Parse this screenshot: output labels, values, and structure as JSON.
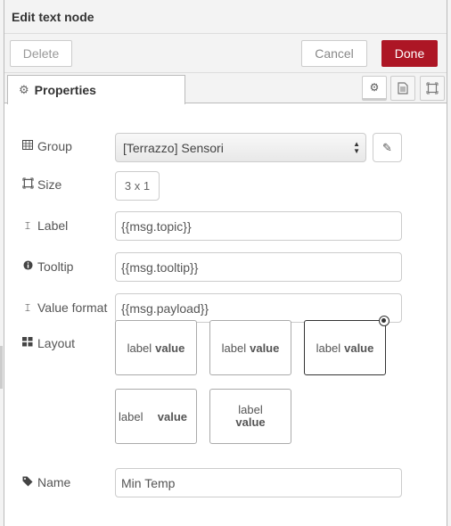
{
  "title": "Edit text node",
  "toolbar": {
    "delete_label": "Delete",
    "cancel_label": "Cancel",
    "done_label": "Done"
  },
  "tabs": [
    {
      "label": "Properties",
      "icon": "gear-icon"
    }
  ],
  "tab_icons": [
    "gear-icon",
    "document-icon",
    "frame-icon"
  ],
  "form": {
    "group": {
      "label": "Group",
      "value": "[Terrazzo] Sensori"
    },
    "size": {
      "label": "Size",
      "value": "3 x 1"
    },
    "label": {
      "label": "Label",
      "value": "{{msg.topic}}"
    },
    "tooltip": {
      "label": "Tooltip",
      "value": "{{msg.tooltip}}"
    },
    "value_format": {
      "label": "Value format",
      "value": "{{msg.payload}}"
    },
    "layout": {
      "label": "Layout",
      "options": [
        {
          "label": "label",
          "value": "value"
        },
        {
          "label": "label",
          "value": "value"
        },
        {
          "label": "label",
          "value": "value",
          "selected": true
        },
        {
          "label": "label",
          "value": "value"
        },
        {
          "label": "label",
          "value": "value"
        }
      ]
    },
    "name": {
      "label": "Name",
      "value": "Min Temp"
    }
  },
  "colors": {
    "done_button": "#ad1625"
  }
}
